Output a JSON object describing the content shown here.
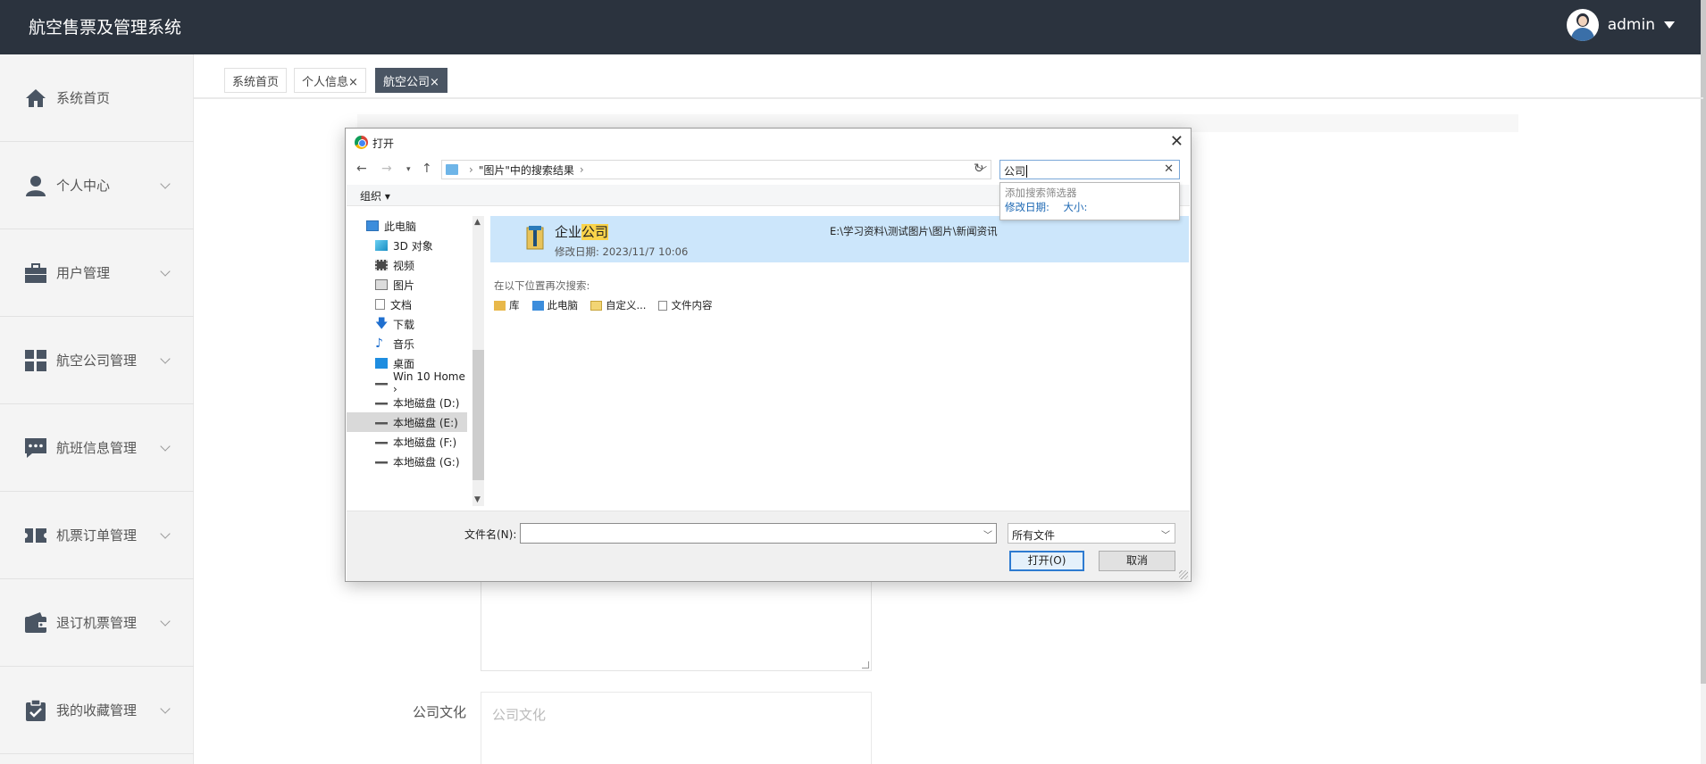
{
  "app": {
    "title": "航空售票及管理系统",
    "user": "admin"
  },
  "sidebar": {
    "items": [
      {
        "label": "系统首页",
        "icon": "home-icon",
        "has_children": false
      },
      {
        "label": "个人中心",
        "icon": "person-icon",
        "has_children": true
      },
      {
        "label": "用户管理",
        "icon": "briefcase-icon",
        "has_children": true
      },
      {
        "label": "航空公司管理",
        "icon": "grid-icon",
        "has_children": true
      },
      {
        "label": "航班信息管理",
        "icon": "chat-icon",
        "has_children": true
      },
      {
        "label": "机票订单管理",
        "icon": "ticket-icon",
        "has_children": true
      },
      {
        "label": "退订机票管理",
        "icon": "wallet-icon",
        "has_children": true
      },
      {
        "label": "我的收藏管理",
        "icon": "clipboard-icon",
        "has_children": true
      }
    ]
  },
  "tabs": [
    {
      "label": "系统首页",
      "closable": false,
      "active": false
    },
    {
      "label": "个人信息×",
      "closable": true,
      "active": false
    },
    {
      "label": "航空公司×",
      "closable": true,
      "active": true
    }
  ],
  "form": {
    "culture_label": "公司文化",
    "culture_placeholder": "公司文化"
  },
  "dialog": {
    "title": "打开",
    "address": "\"图片\"中的搜索结果",
    "search_value": "公司",
    "search_filter": {
      "header": "添加搜索筛选器",
      "options": [
        "修改日期:",
        "大小:"
      ]
    },
    "organize_label": "组织 ▾",
    "tree": [
      {
        "label": "此电脑",
        "icon": "computer-icon",
        "selected": false
      },
      {
        "label": "3D 对象",
        "icon": "3d-objects-icon",
        "selected": false
      },
      {
        "label": "视频",
        "icon": "video-icon",
        "selected": false
      },
      {
        "label": "图片",
        "icon": "pictures-icon",
        "selected": false
      },
      {
        "label": "文档",
        "icon": "documents-icon",
        "selected": false
      },
      {
        "label": "下载",
        "icon": "download-icon",
        "selected": false
      },
      {
        "label": "音乐",
        "icon": "music-icon",
        "selected": false
      },
      {
        "label": "桌面",
        "icon": "desktop-icon",
        "selected": false
      },
      {
        "label": "Win 10 Home ›",
        "icon": "drive-icon",
        "selected": false
      },
      {
        "label": "本地磁盘 (D:)",
        "icon": "drive-icon",
        "selected": false
      },
      {
        "label": "本地磁盘 (E:)",
        "icon": "drive-icon",
        "selected": true
      },
      {
        "label": "本地磁盘 (F:)",
        "icon": "drive-icon",
        "selected": false
      },
      {
        "label": "本地磁盘 (G:)",
        "icon": "drive-icon",
        "selected": false
      }
    ],
    "result": {
      "name_prefix": "企业",
      "name_highlight": "公司",
      "modified": "修改日期: 2023/11/7 10:06",
      "path": "E:\\学习资料\\测试图片\\图片\\新闻资讯"
    },
    "search_again_label": "在以下位置再次搜索:",
    "search_again_options": [
      "库",
      "此电脑",
      "自定义...",
      "文件内容"
    ],
    "filename_label": "文件名(N):",
    "filename_value": "",
    "filetype_value": "所有文件",
    "open_button": "打开(O)",
    "cancel_button": "取消"
  },
  "colors": {
    "topbar": "#2b333e",
    "active_tab": "#4a5563",
    "selection": "#cce6fb",
    "highlight": "#f9d34a"
  }
}
